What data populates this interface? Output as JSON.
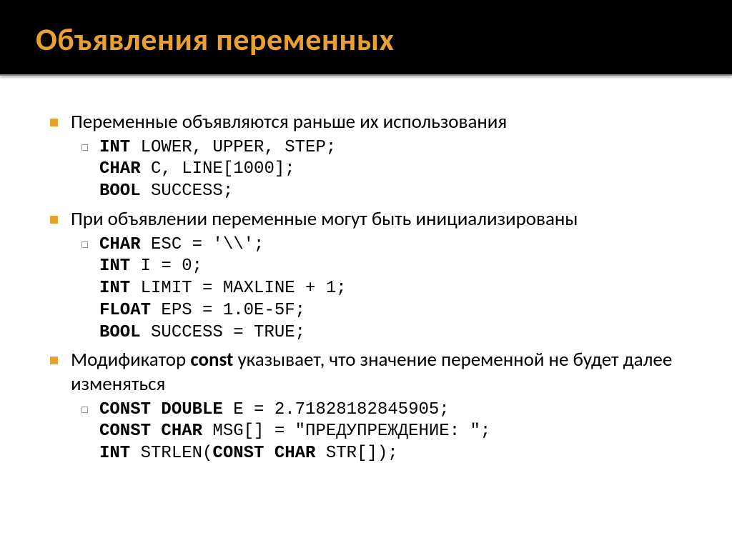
{
  "title": "Объявления переменных",
  "bullets": {
    "b1": "Переменные объявляются раньше их использования",
    "b2": "При объявлении переменные могут быть инициализированы",
    "b3_pre": "Модификатор ",
    "b3_const": "const",
    "b3_post": " указывает, что значение переменной не будет далее изменяться"
  },
  "code1": {
    "l1_kw": "int",
    "l1_rest": " lower, upper, step;",
    "l2_kw": "char",
    "l2_rest": " c, line[1000];",
    "l3_kw": "bool",
    "l3_rest": " success;"
  },
  "code2": {
    "l1_kw": "char",
    "l1_rest": " esc = '\\\\';",
    "l2_kw": "int",
    "l2_rest": " i = 0;",
    "l3_kw": "int",
    "l3_rest": " limit = MAXLINE + 1;",
    "l4_kw": "float",
    "l4_rest": " eps = 1.0e-5f;",
    "l5_kw": "bool",
    "l5_rest": " success = true;"
  },
  "code3": {
    "l1_kw": "const double",
    "l1_rest": " e = 2.71828182845905;",
    "l2_kw": "const char",
    "l2_rest": " msg[] = \"предупреждение: \";",
    "l3_kw1": "int",
    "l3_mid": " strlen(",
    "l3_kw2": "const char",
    "l3_rest": " str[]);"
  }
}
